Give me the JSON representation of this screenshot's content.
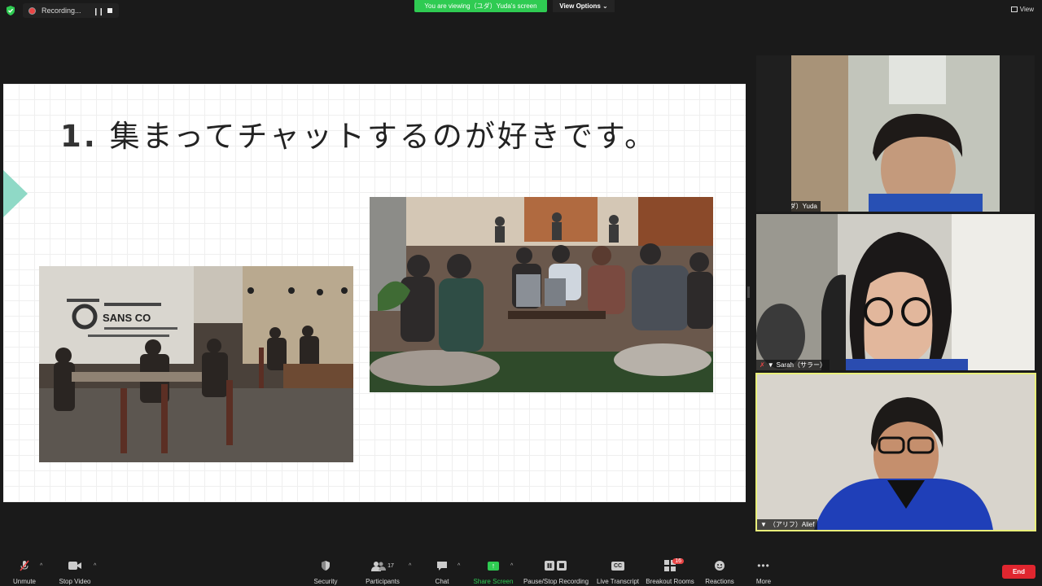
{
  "topbar": {
    "recording_label": "Recording...",
    "viewing_banner": "You are viewing（ユダ）Yuda's screen",
    "view_options_label": "View Options ⌄",
    "view_label": "View"
  },
  "colors": {
    "accent_green": "#2fcb52",
    "end_red": "#e0262f",
    "active_speaker_border": "#e9ef7a",
    "slide_triangle": "#8fd9c6"
  },
  "slide": {
    "title_number": "1.",
    "title_text": "集まってチャットするのが好きです。"
  },
  "participants": [
    {
      "name": "（ユダ）Yuda",
      "muted": true,
      "pinned": true
    },
    {
      "name": "Sarah（サラー）",
      "muted": true,
      "pinned": true
    },
    {
      "name": "（アリフ）Alief",
      "muted": false,
      "pinned": true
    }
  ],
  "toolbar": {
    "unmute": "Unmute",
    "stop_video": "Stop Video",
    "security": "Security",
    "participants": "Participants",
    "participants_count": "17",
    "chat": "Chat",
    "share_screen": "Share Screen",
    "pause_stop_recording": "Pause/Stop Recording",
    "live_transcript": "Live Transcript",
    "breakout_rooms": "Breakout Rooms",
    "breakout_badge": "16",
    "reactions": "Reactions",
    "more": "More",
    "end": "End",
    "cc_icon_text": "CC"
  },
  "icons": [
    "shield-icon",
    "record-icon",
    "pause-icon",
    "stop-icon",
    "mic-off-icon",
    "video-icon",
    "security-shield-icon",
    "participants-icon",
    "chat-icon",
    "share-icon",
    "recording-control-icon",
    "cc-icon",
    "breakout-icon",
    "reactions-icon",
    "more-icon",
    "pin-icon"
  ]
}
